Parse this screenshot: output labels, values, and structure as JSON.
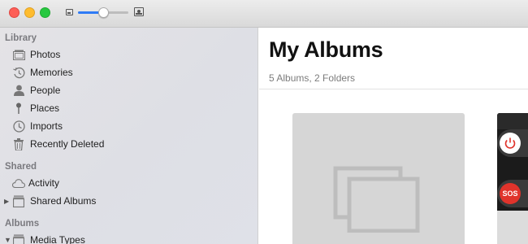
{
  "window": {
    "controls": [
      "close",
      "minimize",
      "maximize"
    ],
    "zoom_level": 0.5
  },
  "sidebar": {
    "sections": [
      {
        "title": "Library",
        "items": [
          {
            "label": "Photos",
            "icon": "photos-icon"
          },
          {
            "label": "Memories",
            "icon": "memories-icon"
          },
          {
            "label": "People",
            "icon": "people-icon"
          },
          {
            "label": "Places",
            "icon": "places-icon"
          },
          {
            "label": "Imports",
            "icon": "imports-icon"
          },
          {
            "label": "Recently Deleted",
            "icon": "trash-icon"
          }
        ]
      },
      {
        "title": "Shared",
        "items": [
          {
            "label": "Activity",
            "icon": "cloud-icon"
          },
          {
            "label": "Shared Albums",
            "icon": "shared-albums-icon",
            "disclosure": "collapsed"
          }
        ]
      },
      {
        "title": "Albums",
        "items": [
          {
            "label": "Media Types",
            "icon": "folder-icon",
            "disclosure": "expanded"
          }
        ]
      }
    ]
  },
  "main": {
    "title": "My Albums",
    "subtitle": "5 Albums, 2 Folders",
    "albums": [
      {
        "type": "empty-placeholder",
        "icon": "album-stack-icon"
      },
      {
        "type": "photo-thumbnail"
      }
    ]
  },
  "colors": {
    "accent": "#2f7bf6",
    "close": "#fd5f57",
    "minimize": "#febc2e",
    "maximize": "#27c840",
    "placeholder": "#d6d6d6",
    "sos": "#e0332b"
  }
}
